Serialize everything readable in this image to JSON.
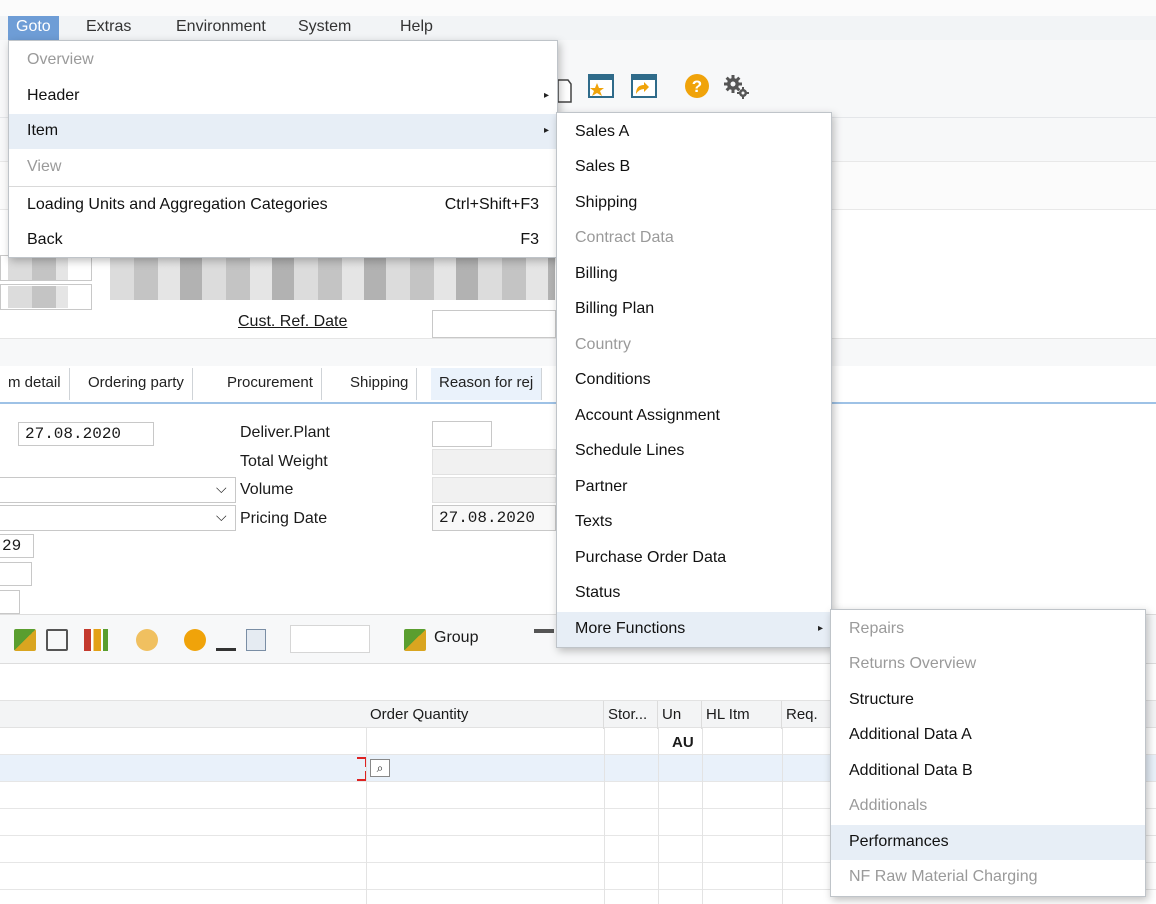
{
  "menubar": {
    "items": [
      {
        "label": "Goto",
        "active": true
      },
      {
        "label": "Extras"
      },
      {
        "label": "Environment"
      },
      {
        "label": "System"
      },
      {
        "label": "Help"
      }
    ]
  },
  "form": {
    "cust_ref_date_label": "Cust. Ref. Date",
    "tabs": [
      "m detail",
      "Ordering party",
      "Procurement",
      "Shipping",
      "Reason for rej"
    ],
    "date_value": "27.08.2020",
    "deliver_plant_label": "Deliver.Plant",
    "total_weight_label": "Total Weight",
    "volume_label": "Volume",
    "pricing_date_label": "Pricing Date",
    "pricing_date_value": "27.08.2020",
    "partial_value": "29"
  },
  "lower_toolbar": {
    "group_label": "Group"
  },
  "grid": {
    "headers": [
      "Order Quantity",
      "Stor...",
      "Un",
      "HL Itm",
      "Req."
    ],
    "row1_unit": "AU"
  },
  "goto_menu": {
    "items": [
      {
        "label": "Overview",
        "disabled": true
      },
      {
        "label": "Header",
        "submenu": true
      },
      {
        "label": "Item",
        "submenu": true,
        "highlighted": true
      },
      {
        "label": "View",
        "disabled": true
      },
      {
        "label": "Loading Units and Aggregation Categories",
        "shortcut": "Ctrl+Shift+F3"
      },
      {
        "label": "Back",
        "shortcut": "F3"
      }
    ]
  },
  "item_menu": {
    "items": [
      {
        "label": "Sales A"
      },
      {
        "label": "Sales B"
      },
      {
        "label": "Shipping"
      },
      {
        "label": "Contract Data",
        "disabled": true
      },
      {
        "label": "Billing"
      },
      {
        "label": "Billing Plan"
      },
      {
        "label": "Country",
        "disabled": true
      },
      {
        "label": "Conditions"
      },
      {
        "label": "Account Assignment"
      },
      {
        "label": "Schedule Lines"
      },
      {
        "label": "Partner"
      },
      {
        "label": "Texts"
      },
      {
        "label": "Purchase Order Data"
      },
      {
        "label": "Status"
      },
      {
        "label": "More Functions",
        "submenu": true,
        "highlighted": true
      }
    ]
  },
  "more_menu": {
    "items": [
      {
        "label": "Repairs",
        "disabled": true
      },
      {
        "label": "Returns Overview",
        "disabled": true
      },
      {
        "label": "Structure"
      },
      {
        "label": "Additional Data A"
      },
      {
        "label": "Additional Data B"
      },
      {
        "label": "Additionals",
        "disabled": true
      },
      {
        "label": "Performances",
        "highlighted": true
      },
      {
        "label": "NF Raw Material Charging",
        "disabled": true
      }
    ]
  },
  "icons": [
    "create-bookmark-icon",
    "bookmarks-icon",
    "help-icon",
    "settings-icon",
    "value-help-icon"
  ],
  "colors": {
    "menu_active": "#6e9dd6",
    "highlight": "#e7eef6",
    "help_orange": "#f0a30a"
  }
}
